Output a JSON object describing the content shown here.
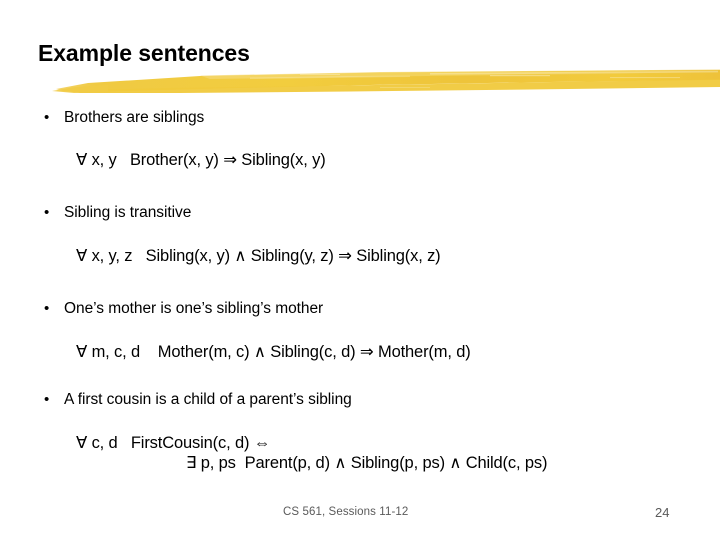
{
  "slide": {
    "title": "Example sentences",
    "accent_color": "#f0c93c",
    "background_color": "#ffffff",
    "text_color": "#000000"
  },
  "bullets": [
    {
      "marker": "•",
      "text": "Brothers are siblings",
      "formula": "∀ x, y   Brother(x, y) ⇒ Sibling(x, y)",
      "formula_line2": ""
    },
    {
      "marker": "•",
      "text": "Sibling is transitive",
      "formula": "∀ x, y, z   Sibling(x, y) ∧ Sibling(y, z) ⇒ Sibling(x, z)",
      "formula_line2": ""
    },
    {
      "marker": "•",
      "text": "One’s mother is one’s sibling’s mother",
      "formula": "∀ m, c, d    Mother(m, c) ∧ Sibling(c, d) ⇒ Mother(m, d)",
      "formula_line2": ""
    },
    {
      "marker": "•",
      "text": "A first cousin is a child of a parent’s sibling",
      "formula": "∀ c, d   FirstCousin(c, d) ⇔",
      "formula_line2": "∃ p, ps  Parent(p, d) ∧ Sibling(p, ps) ∧ Child(c, ps)"
    }
  ],
  "footer": {
    "course": "CS 561,  Sessions 11-12",
    "page_number": "24",
    "color": "#5a5a5a"
  }
}
